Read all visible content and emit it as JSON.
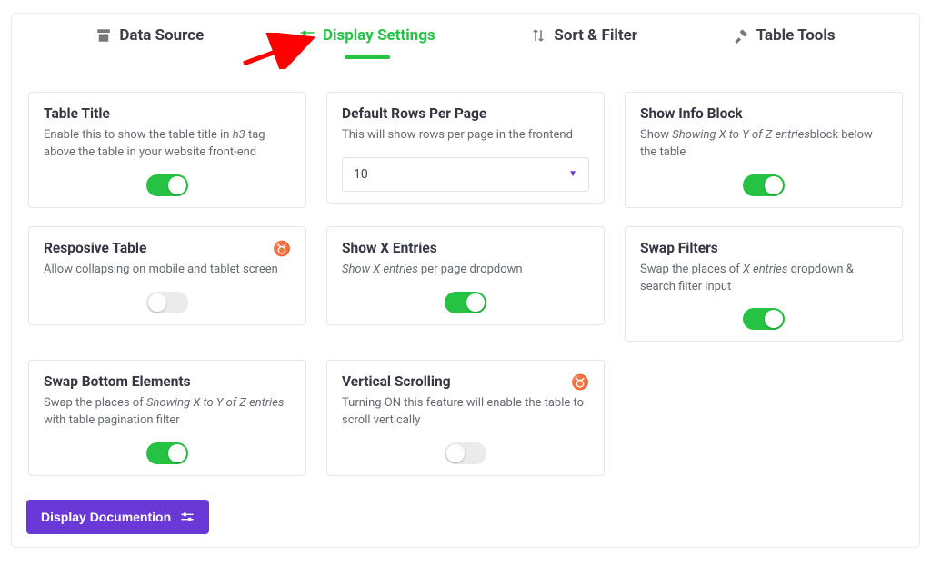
{
  "tabs": [
    {
      "label": "Data Source",
      "icon": "archive-icon",
      "active": false
    },
    {
      "label": "Display Settings",
      "icon": "sliders-icon",
      "active": true
    },
    {
      "label": "Sort & Filter",
      "icon": "sort-icon",
      "active": false
    },
    {
      "label": "Table Tools",
      "icon": "tools-icon",
      "active": false
    }
  ],
  "cards": {
    "table_title": {
      "title": "Table Title",
      "desc_pre": "Enable this to show the table title in ",
      "desc_em": "h3",
      "desc_post": " tag above the table in your website front-end",
      "toggle": true
    },
    "rows_per_page": {
      "title": "Default Rows Per Page",
      "desc": "This will show rows per page in the frontend",
      "value": "10"
    },
    "info_block": {
      "title": "Show Info Block",
      "desc_pre": "Show ",
      "desc_em": "Showing X to Y of Z entries",
      "desc_post": "block below the table",
      "toggle": true
    },
    "responsive": {
      "title": "Resposive Table",
      "desc": "Allow collapsing on mobile and tablet screen",
      "toggle": false,
      "pro": true
    },
    "show_x_entries": {
      "title": "Show X Entries",
      "desc_em": "Show X entries",
      "desc_post": " per page dropdown",
      "toggle": true
    },
    "swap_filters": {
      "title": "Swap Filters",
      "desc_pre": "Swap the places of ",
      "desc_em": "X entries",
      "desc_post": " dropdown & search filter input",
      "toggle": true
    },
    "swap_bottom": {
      "title": "Swap Bottom Elements",
      "desc_pre": "Swap the places of ",
      "desc_em": "Showing X to Y of Z entries",
      "desc_post": " with table pagination filter",
      "toggle": true
    },
    "vertical_scroll": {
      "title": "Vertical Scrolling",
      "desc": "Turning ON this feature will enable the table to scroll vertically",
      "toggle": false,
      "pro": true
    }
  },
  "footer": {
    "doc_btn": "Display Documention"
  }
}
